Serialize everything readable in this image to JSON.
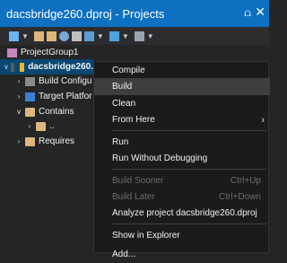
{
  "window": {
    "title": "dacsbridge260.dproj - Projects",
    "pin_icon": "pin-icon",
    "close_icon": "close-icon"
  },
  "toolbar": {
    "icons": [
      "add-icon",
      "new-folder-icon",
      "open-folder-icon",
      "sync-icon",
      "build-icon",
      "compile-icon",
      "run-icon",
      "options-icon"
    ]
  },
  "tree": {
    "project_group": "ProjectGroup1",
    "project": "dacsbridge260.",
    "build_config": "Build Configu",
    "target_platform": "Target Platfor",
    "contains": "Contains",
    "parent": "..",
    "requires": "Requires"
  },
  "context_menu": {
    "items": [
      {
        "label": "Compile"
      },
      {
        "label": "Build"
      },
      {
        "label": "Clean"
      },
      {
        "label": "From Here"
      },
      {
        "label": "Run"
      },
      {
        "label": "Run Without Debugging"
      },
      {
        "label": "Build Sooner",
        "shortcut": "Ctrl+Up"
      },
      {
        "label": "Build Later",
        "shortcut": "Ctrl+Down"
      },
      {
        "label": "Analyze project dacsbridge260.dproj"
      },
      {
        "label": "Show in Explorer"
      },
      {
        "label": "Add..."
      }
    ]
  },
  "colors": {
    "title_bar": "#0e70c0",
    "menu_bg": "#1b1b1c",
    "menu_hover": "#3e3e40",
    "selection": "#094771"
  }
}
